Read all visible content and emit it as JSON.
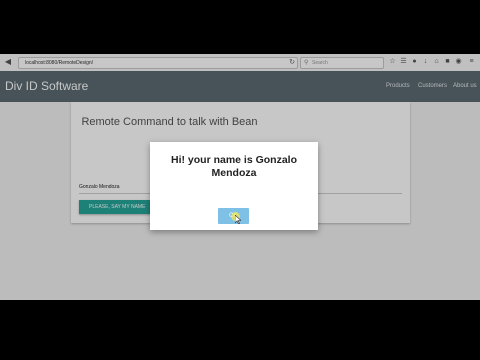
{
  "browser": {
    "url": "localhost:8080/RemoteDesign/",
    "search_placeholder": "Search",
    "icons": [
      "back-icon",
      "forward-icon",
      "reload-icon",
      "search-icon",
      "star-icon",
      "reading-list-icon",
      "lock-icon",
      "download-icon",
      "home-icon",
      "chat-icon",
      "pocket-icon",
      "menu-icon"
    ]
  },
  "app": {
    "title": "Div ID Software",
    "nav": [
      "Products",
      "Customers",
      "About us"
    ]
  },
  "card": {
    "title": "Remote Command to talk with Bean",
    "input_value": "Gonzalo Mendoza",
    "button_label": "PLEASE, SAY MY NAME"
  },
  "dialog": {
    "message": "Hi! your name is Gonzalo Mendoza",
    "ok_label": "OK"
  },
  "colors": {
    "navbar": "#5c6b73",
    "button": "#26a69a",
    "ok_button": "#7fc1e6"
  }
}
